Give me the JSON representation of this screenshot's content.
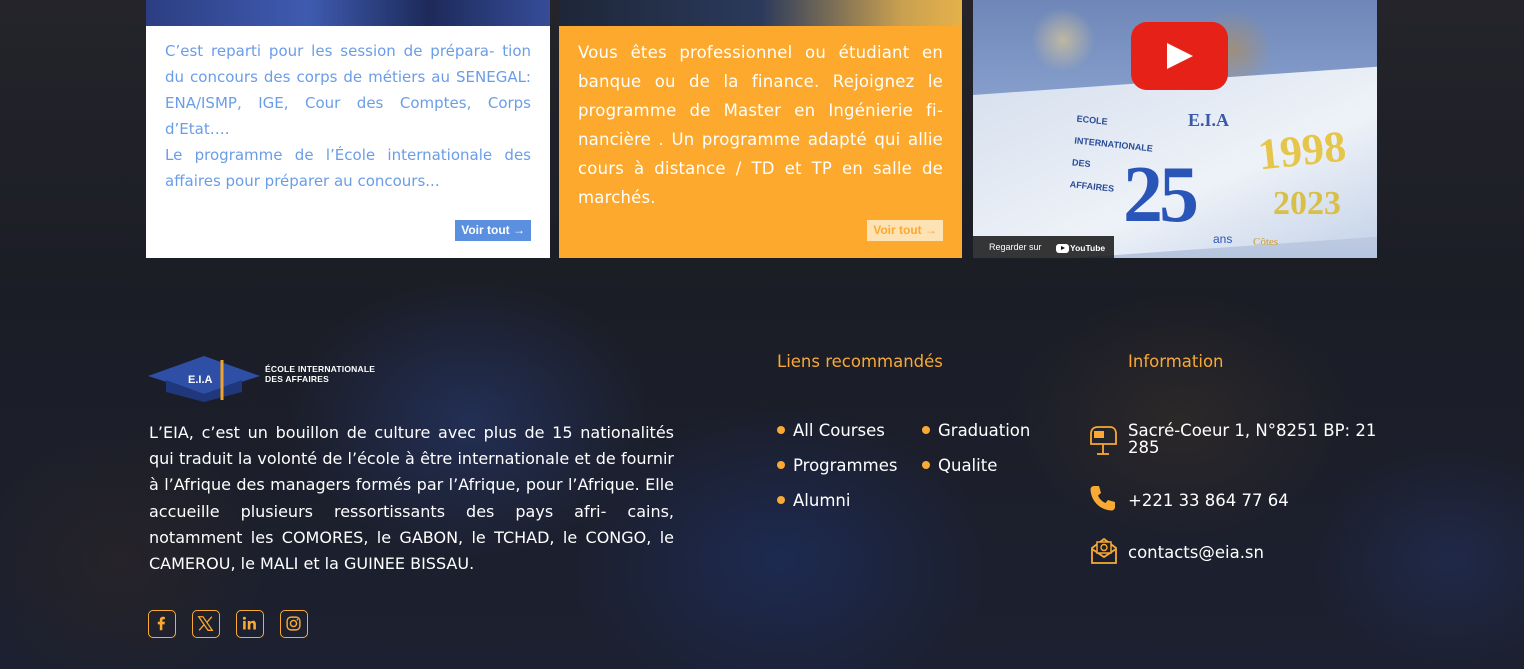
{
  "cards": [
    {
      "paragraphs": [
        "C’est reparti pour les session de prépara- tion du concours des corps de métiers au SENEGAL: ENA/ISMP, IGE, Cour des Comptes, Corps d’Etat….",
        "Le programme de l’École internationale des affaires pour préparer au concours..."
      ],
      "button_label": "Voir tout →"
    },
    {
      "paragraphs": [
        "Vous êtes professionnel ou étudiant en banque ou de la finance. Rejoignez le programme de Master en Ingénierie fi- nancière . Un programme adapté qui allie cours à distance / TD et TP en salle de marchés."
      ],
      "button_label": "Voir tout →"
    }
  ],
  "video": {
    "watch_label": "Regarder sur",
    "platform": "YouTube",
    "play_icon": "play-icon",
    "thumbnail_text": {
      "eia": "E.I.A",
      "number": "25",
      "year_start": "1998",
      "year_end": "2023",
      "side_lines": [
        "ECOLE",
        "INTERNATIONALE",
        "DES",
        "AFFAIRES"
      ],
      "ans": "ans",
      "cotes": "Côtes"
    }
  },
  "footer": {
    "logo": {
      "badge": "E.I.A",
      "name_line1": "ÉCOLE INTERNATIONALE",
      "name_line2": "DES AFFAIRES"
    },
    "about": "L’EIA, c’est un bouillon de culture avec plus de 15 nationalités qui traduit la volonté de l’école à être internationale et de fournir à l’Afrique des managers formés par l’Afrique, pour l’Afrique. Elle accueille plusieurs ressortissants des pays afri- cains, notamment les COMORES, le GABON, le TCHAD, le CONGO, le CAMEROU, le MALI et la GUINEE BISSAU.",
    "social": [
      "facebook-icon",
      "x-twitter-icon",
      "linkedin-icon",
      "instagram-icon"
    ],
    "links_title": "Liens recommandés",
    "links": [
      "All Courses",
      "Graduation",
      "Programmes",
      "Qualite",
      "Alumni"
    ],
    "info_title": "Information",
    "address_line1": "Sacré-Coeur 1, N°8251 BP: 21",
    "address_line2": "285",
    "phone": "+221 33 864 77 64",
    "email": "contacts@eia.sn"
  },
  "colors": {
    "accent": "#f9a934",
    "card_blue_text": "#6a9de8",
    "card_orange": "#fca92e",
    "youtube_red": "#e62117"
  }
}
